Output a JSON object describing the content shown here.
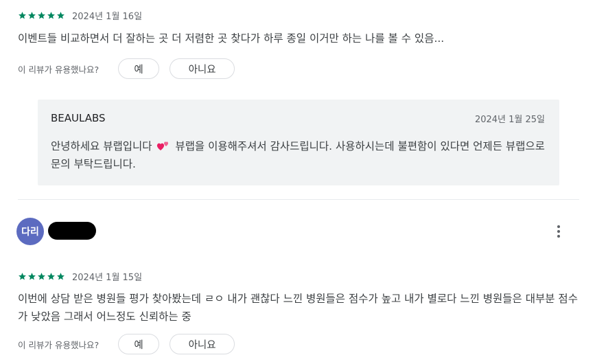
{
  "colors": {
    "star": "#01875f",
    "avatar": "#5c6bc0",
    "reply_bg": "#f1f3f4"
  },
  "reviews": [
    {
      "rating": 5,
      "date": "2024년 1월 16일",
      "text": "이벤트들 비교하면서 더 잘하는 곳 더 저렴한 곳 찾다가 하루 종일 이거만 하는 나를 볼 수 있음...",
      "helpful_question": "이 리뷰가 유용했나요?",
      "yes_label": "예",
      "no_label": "아니요",
      "reply": {
        "name": "BEAULABS",
        "date": "2024년 1월 25일",
        "text_before": "안녕하세요 뷰랩입니다",
        "emoji_icon": "two-hearts-icon",
        "text_after": "뷰랩을 이용해주셔서 감사드립니다. 사용하시는데 불편함이 있다면 언제든 뷰랩으로 문의 부탁드립니다."
      }
    },
    {
      "author_initials": "다리",
      "rating": 5,
      "date": "2024년 1월 15일",
      "text": "이번에 상담 받은 병원들 평가 찾아봤는데 ㄹㅇ 내가 괜찮다 느낀 병원들은 점수가 높고 내가 별로다 느낀 병원들은 대부분 점수가 낮았음 그래서 어느정도 신뢰하는 중",
      "helpful_question": "이 리뷰가 유용했나요?",
      "yes_label": "예",
      "no_label": "아니요",
      "more_icon": "more-vert-icon"
    }
  ]
}
